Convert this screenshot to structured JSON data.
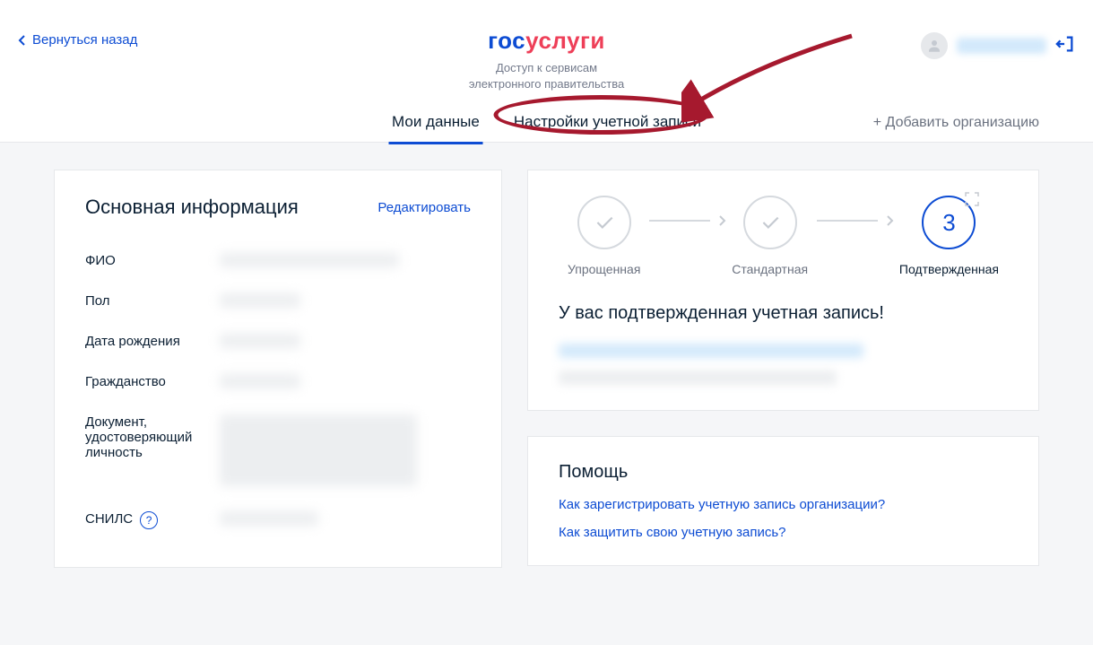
{
  "header": {
    "back": "Вернуться назад",
    "logo_gos": "гос",
    "logo_uslugi": "услуги",
    "subtitle_line1": "Доступ к сервисам",
    "subtitle_line2": "электронного правительства"
  },
  "tabs": {
    "myData": "Мои данные",
    "accountSettings": "Настройки учетной записи",
    "addOrg": "+ Добавить организацию"
  },
  "mainInfo": {
    "title": "Основная информация",
    "edit": "Редактировать",
    "fields": {
      "fio": "ФИО",
      "gender": "Пол",
      "birthDate": "Дата рождения",
      "citizenship": "Гражданство",
      "idDoc": "Документ, удостоверяющий личность",
      "snils": "СНИЛС"
    }
  },
  "status": {
    "step1": "Упрощенная",
    "step2": "Стандартная",
    "step3": "Подтвержденная",
    "step3_num": "3",
    "title": "У вас подтвержденная учетная запись!"
  },
  "help": {
    "title": "Помощь",
    "link1": "Как зарегистрировать учетную запись организации?",
    "link2": "Как защитить свою учетную запись?"
  }
}
